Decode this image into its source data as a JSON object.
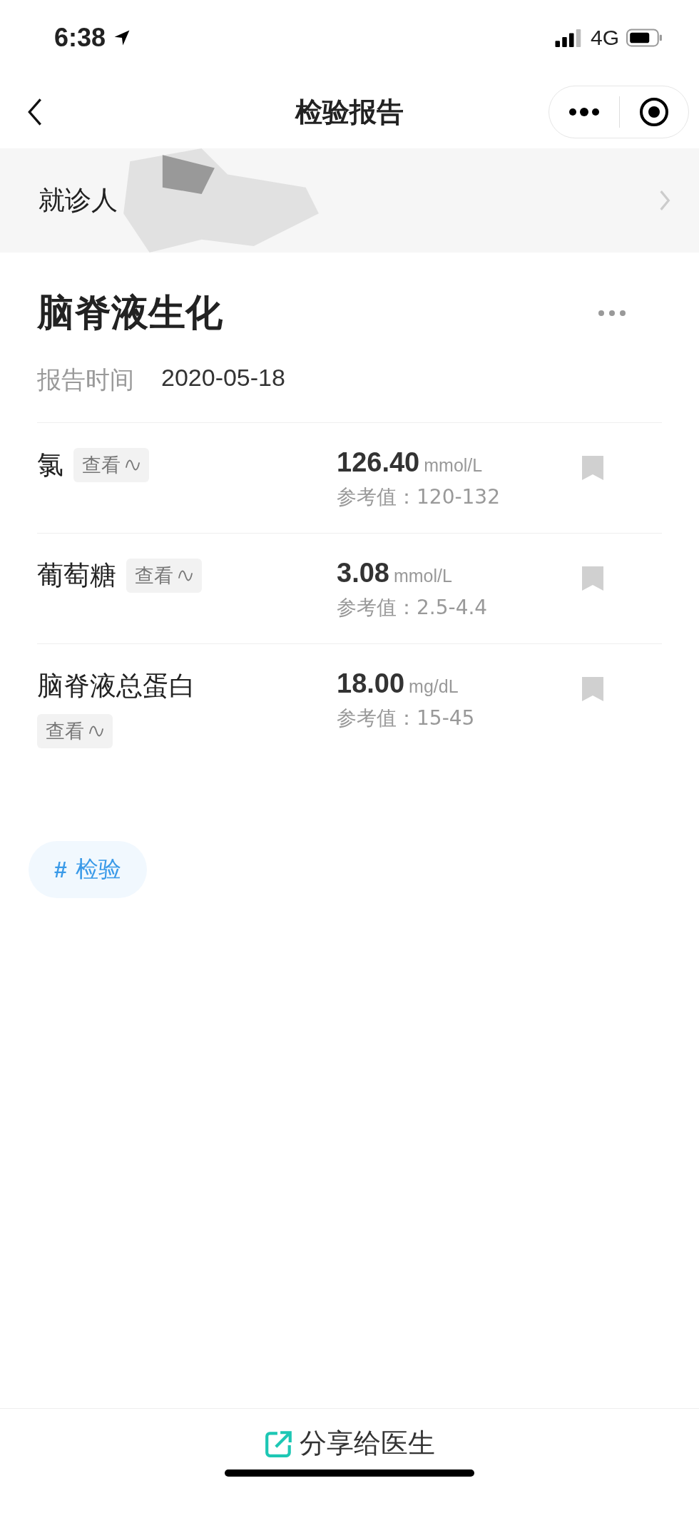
{
  "status_bar": {
    "time": "6:38",
    "network": "4G"
  },
  "nav": {
    "title": "检验报告"
  },
  "patient": {
    "label": "就诊人"
  },
  "report": {
    "title": "脑脊液生化",
    "time_label": "报告时间",
    "time": "2020-05-18"
  },
  "items": [
    {
      "name": "氯",
      "view": "查看",
      "value": "126.40",
      "unit": "mmol/L",
      "reference": "参考值：120-132"
    },
    {
      "name": "葡萄糖",
      "view": "查看",
      "value": "3.08",
      "unit": "mmol/L",
      "reference": "参考值：2.5-4.4"
    },
    {
      "name": "脑脊液总蛋白",
      "view": "查看",
      "value": "18.00",
      "unit": "mg/dL",
      "reference": "参考值：15-45"
    }
  ],
  "tag": {
    "mark": "#",
    "label": "检验"
  },
  "share": {
    "label": "分享给医生"
  }
}
